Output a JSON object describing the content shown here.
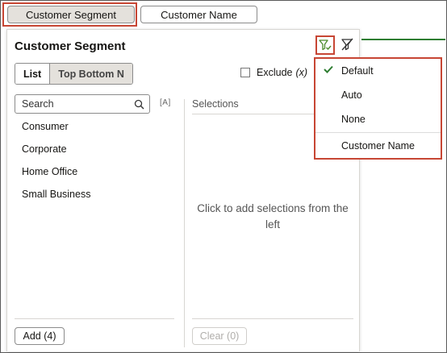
{
  "tabs": [
    {
      "label": "Customer Segment"
    },
    {
      "label": "Customer Name"
    }
  ],
  "panel": {
    "title": "Customer Segment",
    "modes": {
      "list": "List",
      "topbottom": "Top Bottom N"
    },
    "exclude_label": "Exclude",
    "exclude_suffix": "(x)",
    "search_placeholder": "Search",
    "regex_label": "[A]",
    "items": [
      "Consumer",
      "Corporate",
      "Home Office",
      "Small Business"
    ],
    "selections_header": "Selections",
    "empty_hint": "Click to add selections from the left",
    "add_button": "Add (4)",
    "clear_button": "Clear (0)"
  },
  "menu": {
    "items": [
      "Default",
      "Auto",
      "None",
      "Customer Name"
    ],
    "checked": "Default"
  },
  "colors": {
    "accent_red": "#c74634",
    "check_green": "#2e7d32",
    "tab_active_bg": "#e4e1dc"
  }
}
